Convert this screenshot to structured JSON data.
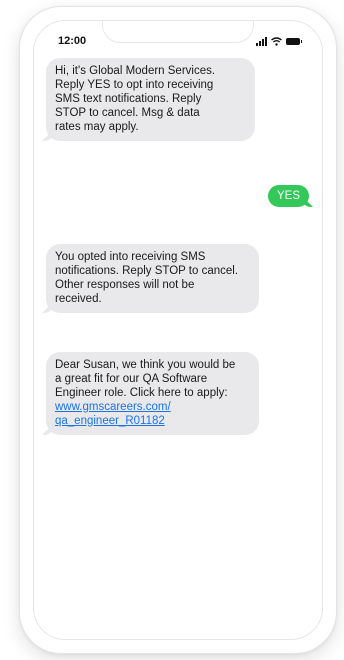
{
  "status_bar": {
    "time": "12:00",
    "icons": [
      "cellular-signal-icon",
      "wifi-icon",
      "battery-icon"
    ]
  },
  "colors": {
    "incoming_bubble": "#e9e9eb",
    "outgoing_bubble": "#34c759",
    "link": "#1a73e8"
  },
  "messages": [
    {
      "direction": "incoming",
      "lines": [
        "Hi, it's Global Modern Services.",
        "Reply YES to opt into receiving",
        "SMS text notifications. Reply",
        "STOP to cancel. Msg & data",
        "rates may apply."
      ]
    },
    {
      "direction": "outgoing",
      "text": "YES"
    },
    {
      "direction": "incoming",
      "lines": [
        "You opted into receiving SMS",
        "notifications. Reply STOP to cancel.",
        "Other responses will not be",
        "received."
      ]
    },
    {
      "direction": "incoming",
      "lines": [
        "Dear Susan, we think you would be",
        "a great fit for our QA Software",
        "Engineer role. Click here to apply:"
      ],
      "link_lines": [
        "www.gmscareers.com/",
        "qa_engineer_R01182"
      ]
    }
  ]
}
